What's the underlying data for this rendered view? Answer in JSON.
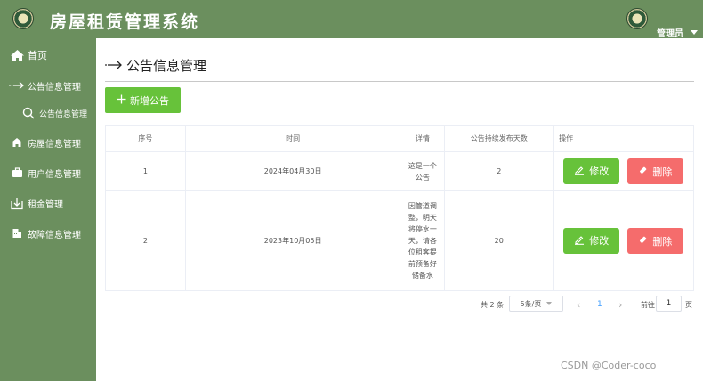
{
  "app": {
    "title": "房屋租赁管理系统"
  },
  "user": {
    "name": "管理员"
  },
  "sidebar": {
    "items": [
      {
        "label": "首页",
        "icon": "home-icon"
      },
      {
        "label": "公告信息管理",
        "icon": "arrow-right-icon"
      },
      {
        "label": "公告信息管理",
        "icon": "search-icon"
      },
      {
        "label": "房屋信息管理",
        "icon": "house-icon"
      },
      {
        "label": "用户信息管理",
        "icon": "briefcase-icon"
      },
      {
        "label": "租金管理",
        "icon": "download-box-icon"
      },
      {
        "label": "故障信息管理",
        "icon": "building-icon"
      }
    ]
  },
  "page": {
    "title": "公告信息管理"
  },
  "toolbar": {
    "add_label": "新增公告"
  },
  "table": {
    "headers": [
      "序号",
      "时间",
      "详情",
      "公告持续发布天数",
      "操作"
    ],
    "edit_label": "修改",
    "delete_label": "删除",
    "rows": [
      {
        "index": "1",
        "time": "2024年04月30日",
        "detail_lines": [
          "这是一个",
          "公告"
        ],
        "days": "2"
      },
      {
        "index": "2",
        "time": "2023年10月05日",
        "detail_lines": [
          "因管道调",
          "整，明天",
          "将停水一",
          "天，请各",
          "位租客提",
          "前预备好",
          "储备水"
        ],
        "days": "20"
      }
    ]
  },
  "pagination": {
    "total_text": "共 2 条",
    "page_size": "5条/页",
    "prev": "‹",
    "current": "1",
    "next": "›",
    "goto_prefix": "前往",
    "goto_value": "1",
    "goto_suffix": "页"
  },
  "watermark": "CSDN @Coder-coco",
  "colors": {
    "sidebar": "#6b8f5e",
    "primary_green": "#67c23a",
    "danger_red": "#f56c6c",
    "page_active": "#409eff"
  }
}
